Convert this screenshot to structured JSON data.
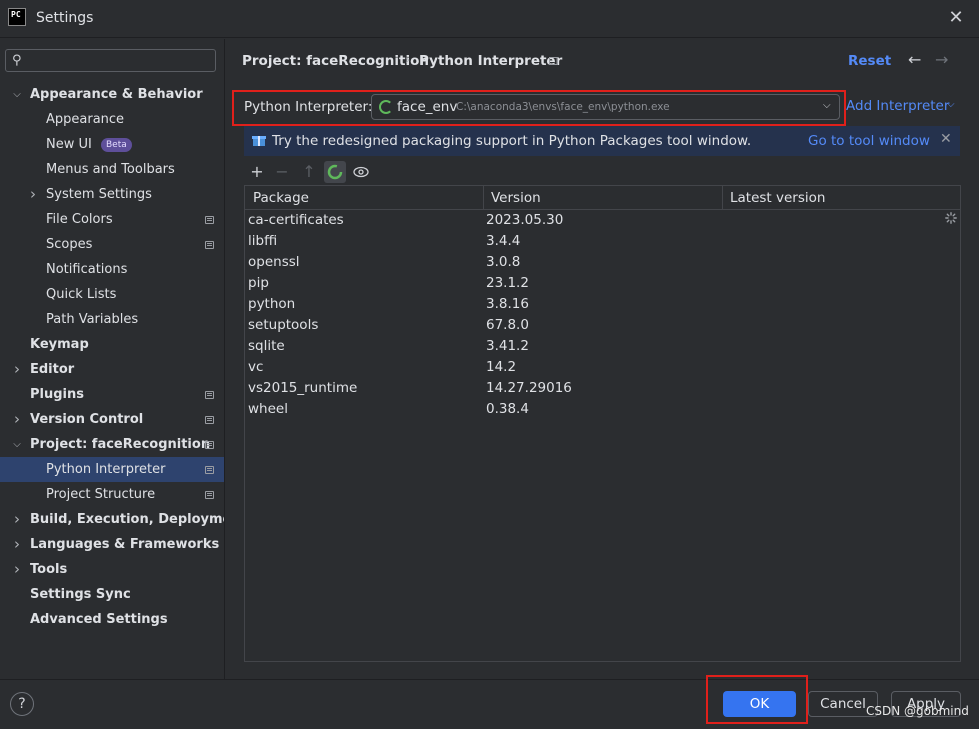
{
  "window": {
    "title": "Settings",
    "app_icon_text": "PC"
  },
  "sidebar": {
    "items": [
      {
        "label": "Appearance & Behavior",
        "level": 0,
        "chevron": "down",
        "bold": true
      },
      {
        "label": "Appearance",
        "level": 1
      },
      {
        "label": "New UI",
        "level": 1,
        "badge": "Beta"
      },
      {
        "label": "Menus and Toolbars",
        "level": 1
      },
      {
        "label": "System Settings",
        "level": 1,
        "chevron": "right"
      },
      {
        "label": "File Colors",
        "level": 1,
        "gear": true
      },
      {
        "label": "Scopes",
        "level": 1,
        "gear": true
      },
      {
        "label": "Notifications",
        "level": 1
      },
      {
        "label": "Quick Lists",
        "level": 1
      },
      {
        "label": "Path Variables",
        "level": 1
      },
      {
        "label": "Keymap",
        "level": 0,
        "bold": true
      },
      {
        "label": "Editor",
        "level": 0,
        "chevron": "right",
        "bold": true
      },
      {
        "label": "Plugins",
        "level": 0,
        "gear": true,
        "bold": true
      },
      {
        "label": "Version Control",
        "level": 0,
        "chevron": "right",
        "gear": true,
        "bold": true
      },
      {
        "label": "Project: faceRecognition",
        "level": 0,
        "chevron": "down",
        "gear": true,
        "bold": true
      },
      {
        "label": "Python Interpreter",
        "level": 1,
        "gear": true,
        "selected": true
      },
      {
        "label": "Project Structure",
        "level": 1,
        "gear": true
      },
      {
        "label": "Build, Execution, Deployment",
        "level": 0,
        "chevron": "right",
        "bold": true
      },
      {
        "label": "Languages & Frameworks",
        "level": 0,
        "chevron": "right",
        "bold": true
      },
      {
        "label": "Tools",
        "level": 0,
        "chevron": "right",
        "bold": true
      },
      {
        "label": "Settings Sync",
        "level": 0,
        "bold": true
      },
      {
        "label": "Advanced Settings",
        "level": 0,
        "bold": true
      }
    ]
  },
  "header": {
    "breadcrumb_project": "Project: faceRecognition",
    "breadcrumb_sep": "›",
    "breadcrumb_page": "Python Interpreter",
    "reset": "Reset",
    "back": "←",
    "forward": "→"
  },
  "interpreter": {
    "label": "Python Interpreter:",
    "env_name": "face_env",
    "env_path": "C:\\anaconda3\\envs\\face_env\\python.exe",
    "add_label": "Add Interpreter"
  },
  "banner": {
    "text": "Try the redesigned packaging support in Python Packages tool window.",
    "link": "Go to tool window"
  },
  "table": {
    "columns": [
      "Package",
      "Version",
      "Latest version"
    ],
    "rows": [
      [
        "ca-certificates",
        "2023.05.30",
        ""
      ],
      [
        "libffi",
        "3.4.4",
        ""
      ],
      [
        "openssl",
        "3.0.8",
        ""
      ],
      [
        "pip",
        "23.1.2",
        ""
      ],
      [
        "python",
        "3.8.16",
        ""
      ],
      [
        "setuptools",
        "67.8.0",
        ""
      ],
      [
        "sqlite",
        "3.41.2",
        ""
      ],
      [
        "vc",
        "14.2",
        ""
      ],
      [
        "vs2015_runtime",
        "14.27.29016",
        ""
      ],
      [
        "wheel",
        "0.38.4",
        ""
      ]
    ]
  },
  "footer": {
    "help": "?",
    "ok": "OK",
    "cancel": "Cancel",
    "apply": "Apply"
  },
  "watermark": "CSDN @gobmind",
  "colors": {
    "accent": "#3574f0",
    "link": "#548af7",
    "highlight_box": "#e0201b",
    "selection": "#2e436e",
    "banner": "#25324d"
  }
}
